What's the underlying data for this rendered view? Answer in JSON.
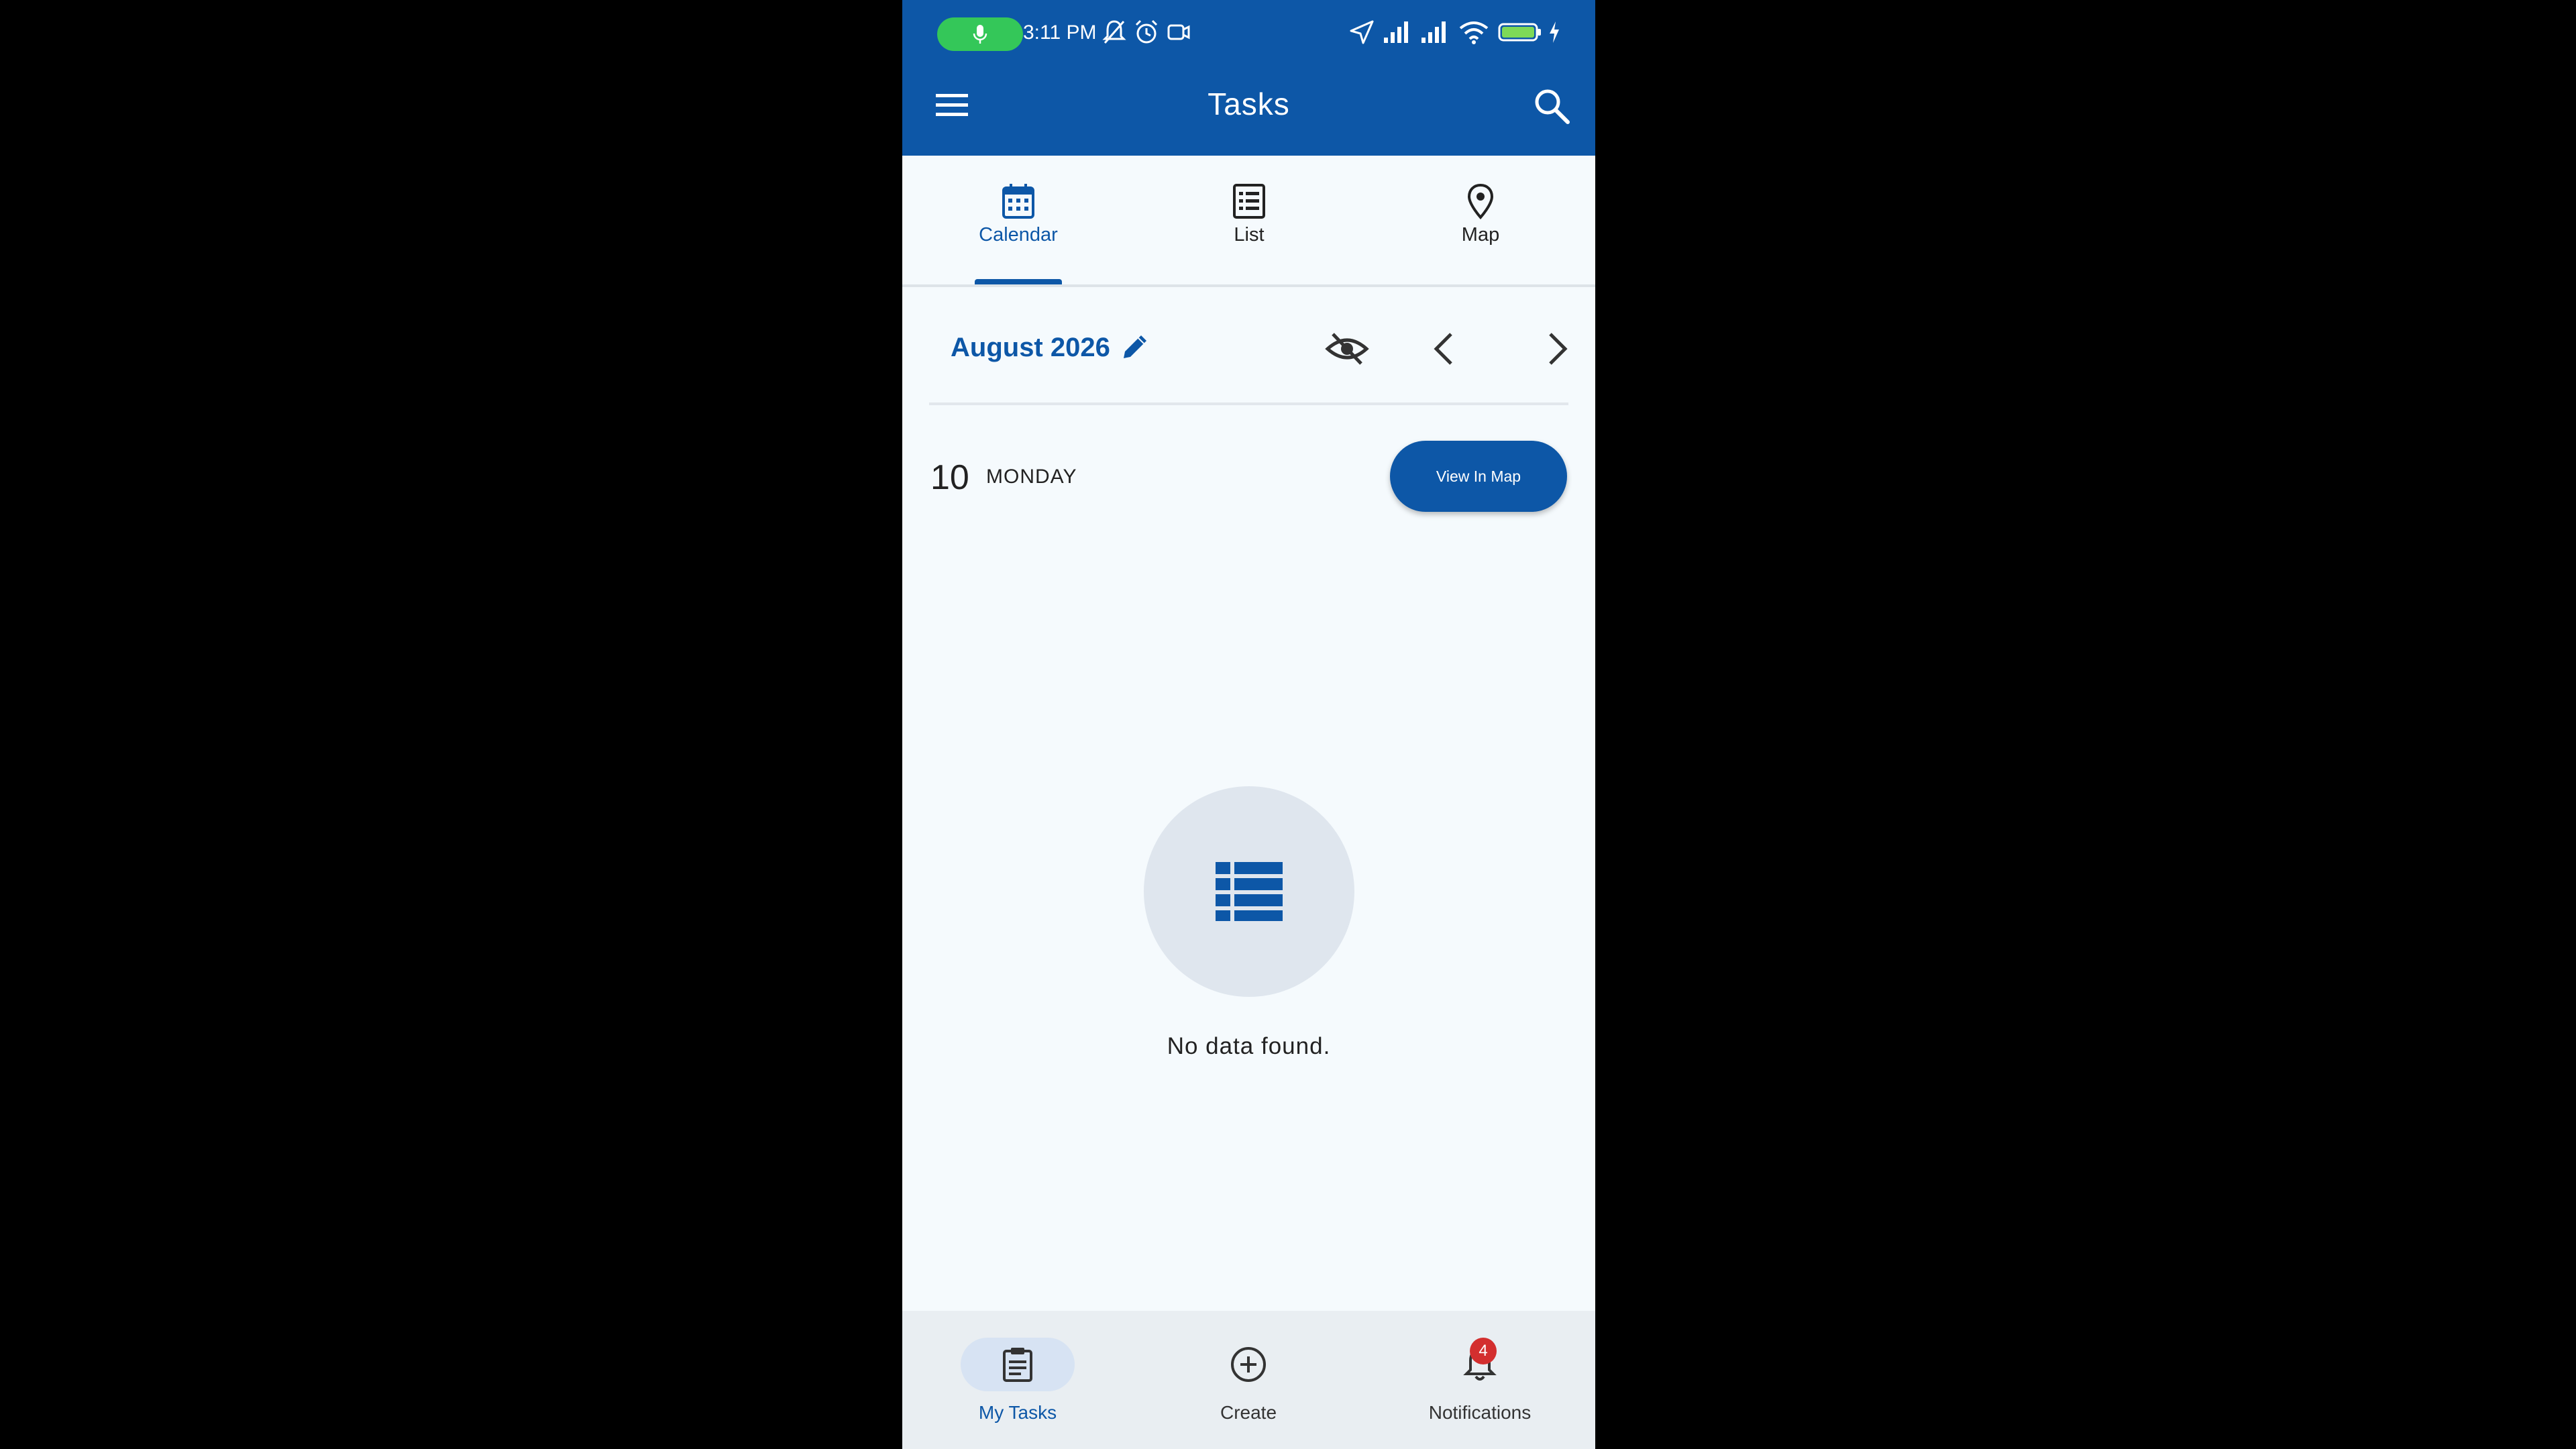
{
  "status_bar": {
    "time": "3:11 PM",
    "icons": [
      "mic-icon",
      "mute-bell-icon",
      "alarm-icon",
      "camera-icon",
      "location-arrow-icon",
      "signal-icon",
      "signal-icon",
      "wifi-icon",
      "battery-icon",
      "charging-icon"
    ]
  },
  "app_bar": {
    "title": "Tasks",
    "menu_icon": "hamburger-menu-icon",
    "search_icon": "search-icon"
  },
  "tabs": [
    {
      "label": "Calendar",
      "icon": "calendar-icon",
      "active": true
    },
    {
      "label": "List",
      "icon": "list-icon",
      "active": false
    },
    {
      "label": "Map",
      "icon": "map-pin-icon",
      "active": false
    }
  ],
  "calendar_header": {
    "month_label": "August 2026",
    "edit_icon": "pencil-icon",
    "hide_icon": "eye-off-icon",
    "prev_icon": "chevron-left-icon",
    "next_icon": "chevron-right-icon"
  },
  "day": {
    "number": "10",
    "weekday": "MONDAY",
    "view_map_label": "View In Map"
  },
  "empty_state": {
    "icon": "table-list-icon",
    "message": "No data found."
  },
  "bottom_nav": [
    {
      "label": "My Tasks",
      "icon": "clipboard-icon",
      "active": true
    },
    {
      "label": "Create",
      "icon": "plus-circle-icon",
      "active": false
    },
    {
      "label": "Notifications",
      "icon": "bell-icon",
      "active": false,
      "badge": "4"
    }
  ],
  "colors": {
    "primary": "#0d57a7",
    "background": "#f5fafd",
    "badge": "#d32f2f",
    "mic_pill": "#34c759"
  }
}
